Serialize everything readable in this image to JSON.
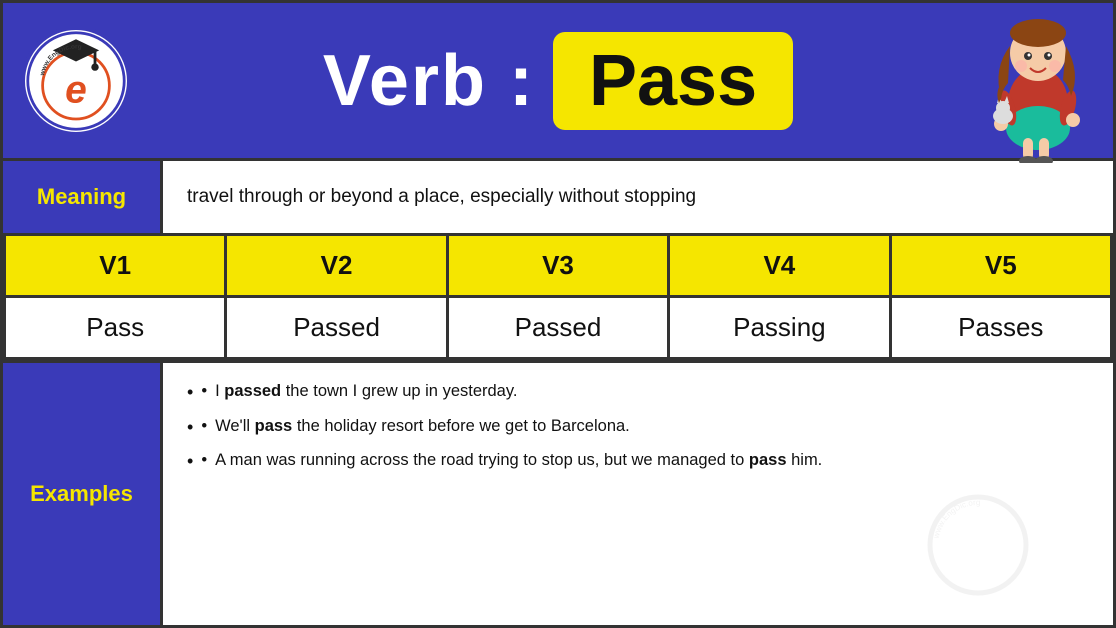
{
  "header": {
    "logo_text_top": "www.EngDic.org",
    "verb_label": "Verb :",
    "word": "Pass"
  },
  "meaning": {
    "badge_label": "Meaning",
    "text": "travel through or beyond a place, especially without stopping"
  },
  "table": {
    "headers": [
      "V1",
      "V2",
      "V3",
      "V4",
      "V5"
    ],
    "values": [
      "Pass",
      "Passed",
      "Passed",
      "Passing",
      "Passes"
    ]
  },
  "examples": {
    "badge_label": "Examples",
    "items": [
      {
        "text_before": "I ",
        "bold": "passed",
        "text_after": " the town I grew up in yesterday."
      },
      {
        "text_before": "We'll ",
        "bold": "pass",
        "text_after": " the holiday resort before we get to Barcelona."
      },
      {
        "text_before": "A man was running across the road trying to stop us, but we managed to ",
        "bold": "pass",
        "text_after": " him."
      }
    ]
  }
}
